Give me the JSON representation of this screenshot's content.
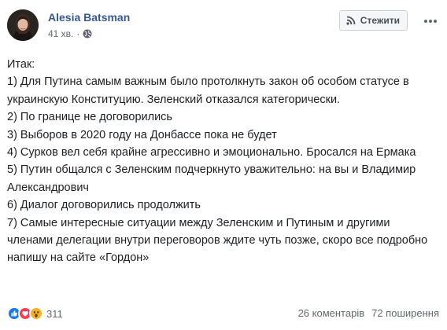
{
  "post": {
    "author": "Alesia Batsman",
    "time": "41 хв.",
    "separator": "·",
    "privacy_icon": "globe-icon",
    "follow_label": "Стежити",
    "follow_icon": "rss-icon",
    "more_icon": "more-horizontal-icon",
    "lines": [
      "Итак:",
      "1) Для Путина самым важным было протолкнуть закон об особом статусе в украинскую Конституцию. Зеленский отказался категорически.",
      "2) По границе не договорились",
      "3) Выборов в 2020 году на Донбассе пока не будет",
      "4) Сурков вел себя крайне агрессивно и эмоционально. Бросался на Ермака",
      "5) Путин общался с Зеленским подчеркнуто уважительно: на вы и Владимир Александрович",
      "6) Диалог договорились продолжить",
      "7) Самые интересные ситуации между Зеленским и Путиным и другими членами делегации внутри переговоров ждите чуть позже, скоро все подробно напишу на сайте «Гордон»"
    ]
  },
  "footer": {
    "reactions": [
      "like-reaction-icon",
      "love-reaction-icon",
      "wow-reaction-icon"
    ],
    "reaction_count": "311",
    "comments": "26 коментарів",
    "shares": "72 поширення"
  },
  "colors": {
    "link": "#385898",
    "meta": "#606770",
    "text": "#1c1e21",
    "like": "#1877f2",
    "love": "#f33e58",
    "wow": "#f7b125"
  }
}
